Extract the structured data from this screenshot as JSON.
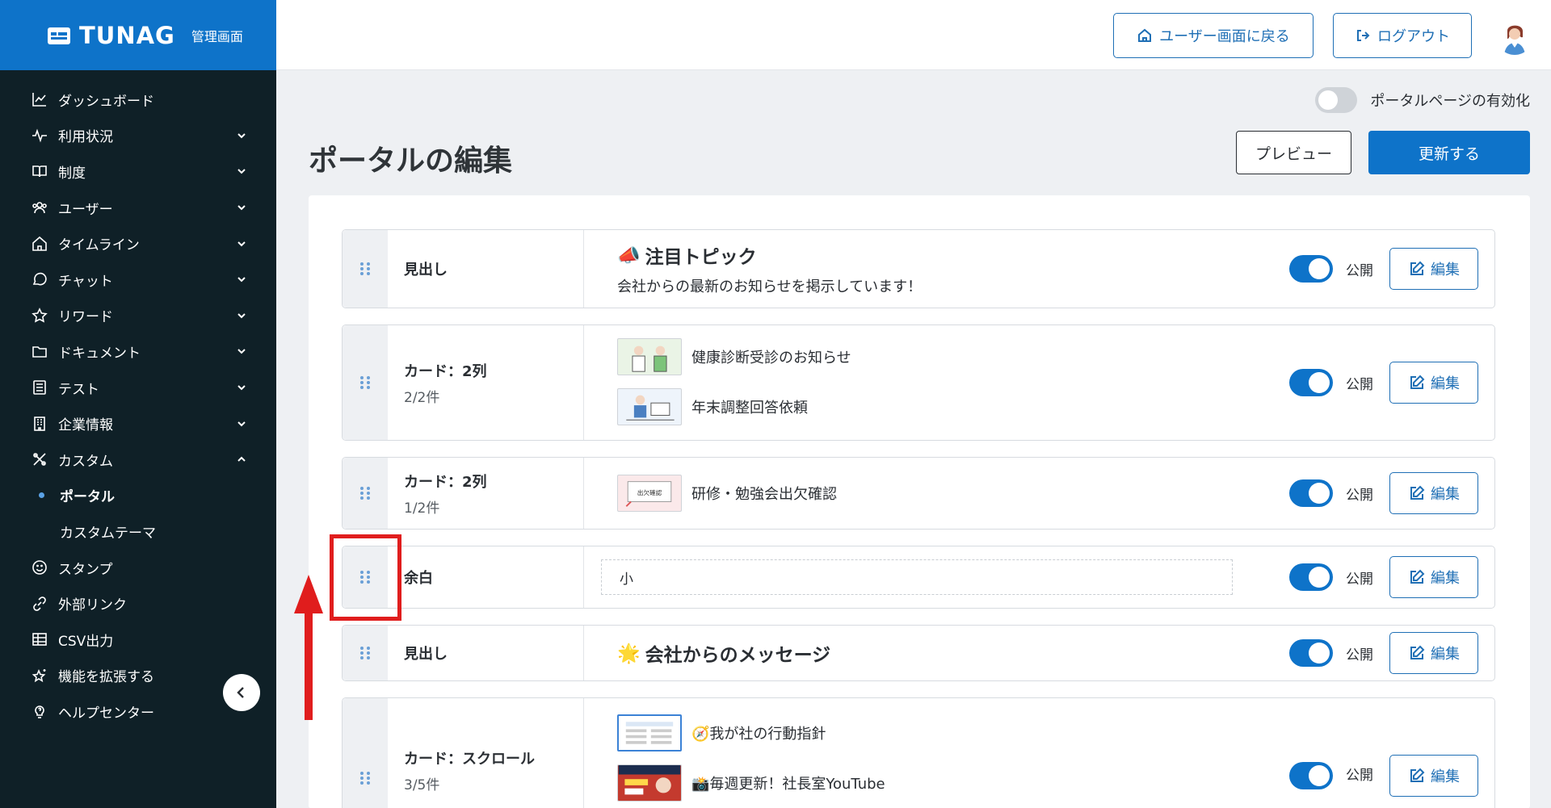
{
  "brand": {
    "name": "TUNAG",
    "subtitle": "管理画面"
  },
  "sidebar": {
    "items": [
      {
        "label": "ダッシュボード",
        "icon": "chart-line-icon",
        "has_chevron": false
      },
      {
        "label": "利用状況",
        "icon": "activity-icon",
        "has_chevron": true,
        "chevron": "down"
      },
      {
        "label": "制度",
        "icon": "book-icon",
        "has_chevron": true,
        "chevron": "down"
      },
      {
        "label": "ユーザー",
        "icon": "users-icon",
        "has_chevron": true,
        "chevron": "down"
      },
      {
        "label": "タイムライン",
        "icon": "home-icon",
        "has_chevron": true,
        "chevron": "down"
      },
      {
        "label": "チャット",
        "icon": "chat-bubble-icon",
        "has_chevron": true,
        "chevron": "down"
      },
      {
        "label": "リワード",
        "icon": "star-icon",
        "has_chevron": true,
        "chevron": "down"
      },
      {
        "label": "ドキュメント",
        "icon": "folder-icon",
        "has_chevron": true,
        "chevron": "down"
      },
      {
        "label": "テスト",
        "icon": "checklist-icon",
        "has_chevron": true,
        "chevron": "down"
      },
      {
        "label": "企業情報",
        "icon": "building-icon",
        "has_chevron": true,
        "chevron": "down"
      },
      {
        "label": "カスタム",
        "icon": "tools-icon",
        "has_chevron": true,
        "chevron": "up"
      }
    ],
    "sub_items": [
      {
        "label": "ポータル",
        "active": true
      },
      {
        "label": "カスタムテーマ",
        "active": false
      }
    ],
    "bottom_items": [
      {
        "label": "スタンプ",
        "icon": "smile-icon"
      },
      {
        "label": "外部リンク",
        "icon": "link-icon"
      },
      {
        "label": "CSV出力",
        "icon": "table-icon"
      },
      {
        "label": "機能を拡張する",
        "icon": "sparkle-star-icon"
      },
      {
        "label": "ヘルプセンター",
        "icon": "help-bulb-icon"
      }
    ]
  },
  "header": {
    "back_label": "ユーザー画面に戻る",
    "logout_label": "ログアウト"
  },
  "page": {
    "portal_toggle_label": "ポータルページの有効化",
    "portal_enabled": false,
    "title": "ポータルの編集",
    "preview_label": "プレビュー",
    "update_label": "更新する"
  },
  "rows": [
    {
      "type": "見出し",
      "count": "",
      "kind": "heading",
      "title": "注目トピック",
      "emoji": "📣",
      "subtitle": "会社からの最新のお知らせを掲示しています！",
      "public_label": "公開",
      "edit_label": "編集"
    },
    {
      "type": "カード：2列",
      "count": "2/2件",
      "kind": "cards",
      "cards": [
        "健康診断受診のお知らせ",
        "年末調整回答依頼"
      ],
      "public_label": "公開",
      "edit_label": "編集"
    },
    {
      "type": "カード：2列",
      "count": "1/2件",
      "kind": "cards",
      "cards": [
        "研修・勉強会出欠確認"
      ],
      "public_label": "公開",
      "edit_label": "編集"
    },
    {
      "type": "余白",
      "count": "",
      "kind": "spacer",
      "value": "小",
      "public_label": "公開",
      "edit_label": "編集"
    },
    {
      "type": "見出し",
      "count": "",
      "kind": "heading",
      "title": "会社からのメッセージ",
      "emoji": "🌟",
      "subtitle": "",
      "public_label": "公開",
      "edit_label": "編集"
    },
    {
      "type": "カード：スクロール",
      "count": "3/5件",
      "kind": "cards",
      "cards": [
        "🧭我が社の行動指針",
        "📸毎週更新！社長室YouTube"
      ],
      "public_label": "公開",
      "edit_label": "編集"
    }
  ],
  "thumb_text": "出欠確認",
  "colors": {
    "brand": "#0e73c9",
    "sidebar": "#0f2027",
    "annotation": "#e01d1d"
  }
}
